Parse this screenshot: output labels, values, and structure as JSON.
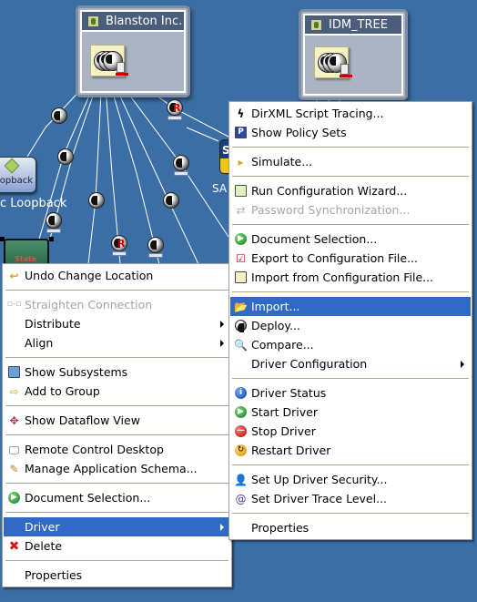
{
  "diagram": {
    "trees": [
      {
        "title": "Blanston Inc.",
        "icon": "tree-icon"
      },
      {
        "title": "IDM_TREE",
        "icon": "tree-icon"
      }
    ],
    "nodes": {
      "loopback_icon_text": "oopback",
      "loopback_label": "c Loopback",
      "sap_icon_text": "S",
      "sap_label": "SA",
      "state_icon_text": "State"
    }
  },
  "left_menu": {
    "items": [
      {
        "label": "Undo Change Location",
        "icon": "undo-arrow-icon",
        "enabled": true
      },
      {
        "type": "separator"
      },
      {
        "label": "Straighten Connection",
        "icon": "straighten-connection-icon",
        "enabled": false
      },
      {
        "label": "Distribute",
        "submenu": true,
        "enabled": true
      },
      {
        "label": "Align",
        "submenu": true,
        "enabled": true
      },
      {
        "type": "separator"
      },
      {
        "label": "Show Subsystems",
        "icon": "subsystems-icon",
        "enabled": true
      },
      {
        "label": "Add to Group",
        "icon": "add-to-group-icon",
        "enabled": true
      },
      {
        "type": "separator"
      },
      {
        "label": "Show Dataflow View",
        "icon": "dataflow-icon",
        "enabled": true
      },
      {
        "type": "separator"
      },
      {
        "label": "Remote Control Desktop",
        "icon": "remote-desktop-icon",
        "enabled": true
      },
      {
        "label": "Manage Application Schema...",
        "icon": "schema-icon",
        "enabled": true
      },
      {
        "type": "separator"
      },
      {
        "label": "Document Selection...",
        "icon": "document-selection-icon",
        "enabled": true
      },
      {
        "type": "separator"
      },
      {
        "label": "Driver",
        "submenu": true,
        "enabled": true,
        "selected": true
      },
      {
        "label": "Delete",
        "icon": "delete-x-icon",
        "enabled": true
      },
      {
        "type": "separator"
      },
      {
        "label": "Properties",
        "enabled": true
      }
    ]
  },
  "right_menu": {
    "items": [
      {
        "label": "DirXML Script Tracing...",
        "icon": "script-tracing-icon",
        "enabled": true
      },
      {
        "label": "Show Policy Sets",
        "icon": "policy-sets-icon",
        "enabled": true
      },
      {
        "type": "separator"
      },
      {
        "label": "Simulate...",
        "icon": "simulate-icon",
        "enabled": true
      },
      {
        "type": "separator"
      },
      {
        "label": "Run Configuration Wizard...",
        "icon": "config-wizard-icon",
        "enabled": true
      },
      {
        "label": "Password Synchronization...",
        "icon": "password-sync-icon",
        "enabled": false
      },
      {
        "type": "separator"
      },
      {
        "label": "Document Selection...",
        "icon": "document-selection-icon",
        "enabled": true
      },
      {
        "label": "Export to Configuration File...",
        "icon": "export-config-icon",
        "enabled": true
      },
      {
        "label": "Import from Configuration File...",
        "icon": "import-config-icon",
        "enabled": true
      },
      {
        "type": "separator"
      },
      {
        "label": "Import...",
        "icon": "folder-open-icon",
        "enabled": true,
        "selected": true
      },
      {
        "label": "Deploy...",
        "icon": "deploy-icon",
        "enabled": true
      },
      {
        "label": "Compare...",
        "icon": "compare-icon",
        "enabled": true
      },
      {
        "label": "Driver Configuration",
        "submenu": true,
        "enabled": true
      },
      {
        "type": "separator"
      },
      {
        "label": "Driver Status",
        "icon": "info-icon",
        "enabled": true
      },
      {
        "label": "Start Driver",
        "icon": "start-icon",
        "enabled": true
      },
      {
        "label": "Stop Driver",
        "icon": "stop-icon",
        "enabled": true
      },
      {
        "label": "Restart Driver",
        "icon": "restart-icon",
        "enabled": true
      },
      {
        "type": "separator"
      },
      {
        "label": "Set Up Driver Security...",
        "icon": "driver-security-icon",
        "enabled": true
      },
      {
        "label": "Set Driver Trace Level...",
        "icon": "trace-level-icon",
        "enabled": true
      },
      {
        "type": "separator"
      },
      {
        "label": "Properties",
        "enabled": true
      }
    ]
  },
  "colors": {
    "desktop": "#3a6ea5",
    "selection": "#316ac5",
    "disabled_text": "#a7a69e",
    "tree_title_bar": "#4a5e7c"
  }
}
